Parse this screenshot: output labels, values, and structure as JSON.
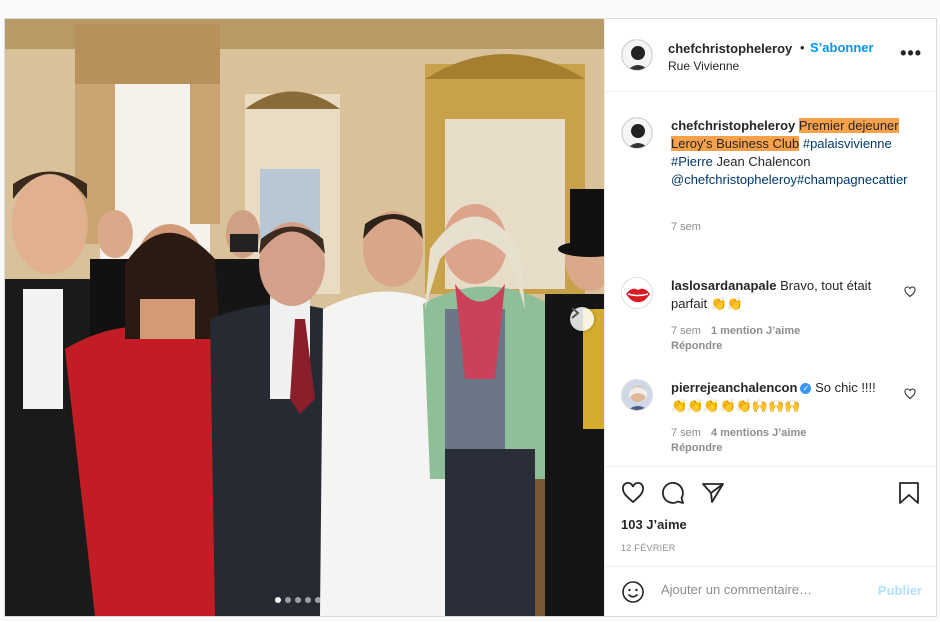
{
  "post": {
    "username": "chefchristopheleroy",
    "separator": "•",
    "follow_label": "S’abonner",
    "location": "Rue Vivienne",
    "more_label": "•••"
  },
  "caption": {
    "username": "chefchristopheleroy",
    "highlight": "Premier dejeuner Leroy's Business Club",
    "tag1": "#palaisvivienne",
    "tag2": "#Pierre",
    "plain": "Jean Chalencon",
    "mention": "@chefchristopheleroy",
    "tag3": "#champagnecattier",
    "time": "7 sem"
  },
  "comments": [
    {
      "username": "laslosardanapale",
      "text": "Bravo, tout était parfait 👏👏",
      "time": "7 sem",
      "likes": "1 mention J’aime",
      "reply": "Répondre"
    },
    {
      "username": "pierrejeanchalencon",
      "verified_icon": "✓",
      "text": "So chic !!!! 👏👏👏👏👏🙌🙌🙌",
      "time": "7 sem",
      "likes": "4 mentions J’aime",
      "reply": "Répondre"
    }
  ],
  "actions": {
    "likes": "103 J’aime",
    "date": "12 FÉVRIER"
  },
  "composer": {
    "placeholder": "Ajouter un commentaire…",
    "publish": "Publier"
  },
  "carousel": {
    "slides": 5,
    "active_slide": 1
  },
  "colors": {
    "highlight": "#f7a14b",
    "link": "#0095f6",
    "tag": "#00376b",
    "muted": "#8e8e8e"
  }
}
